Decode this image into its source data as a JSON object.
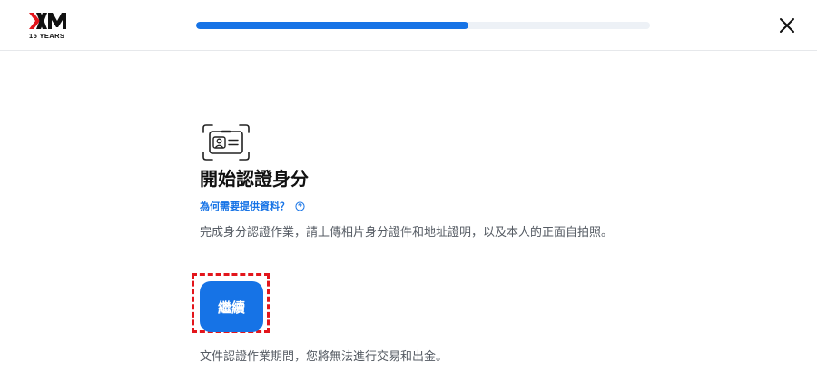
{
  "header": {
    "logo_text": "XM",
    "logo_tagline": "15 YEARS",
    "progress_percent": 60,
    "close_icon": "close-icon"
  },
  "main": {
    "icon": "id-card-scan-icon",
    "title": "開始認證身分",
    "why_link": "為何需要提供資料？",
    "help_icon": "question-circle-icon",
    "description": "完成身分認證作業，請上傳相片身分證件和地址證明，以及本人的正面自拍照。",
    "continue_label": "繼續",
    "note": "文件認證作業期間，您將無法進行交易和出金。"
  },
  "colors": {
    "accent": "#1673e6",
    "progress_track": "#edf1f6",
    "highlight_border": "#e3151b",
    "body_text": "#555b63"
  }
}
